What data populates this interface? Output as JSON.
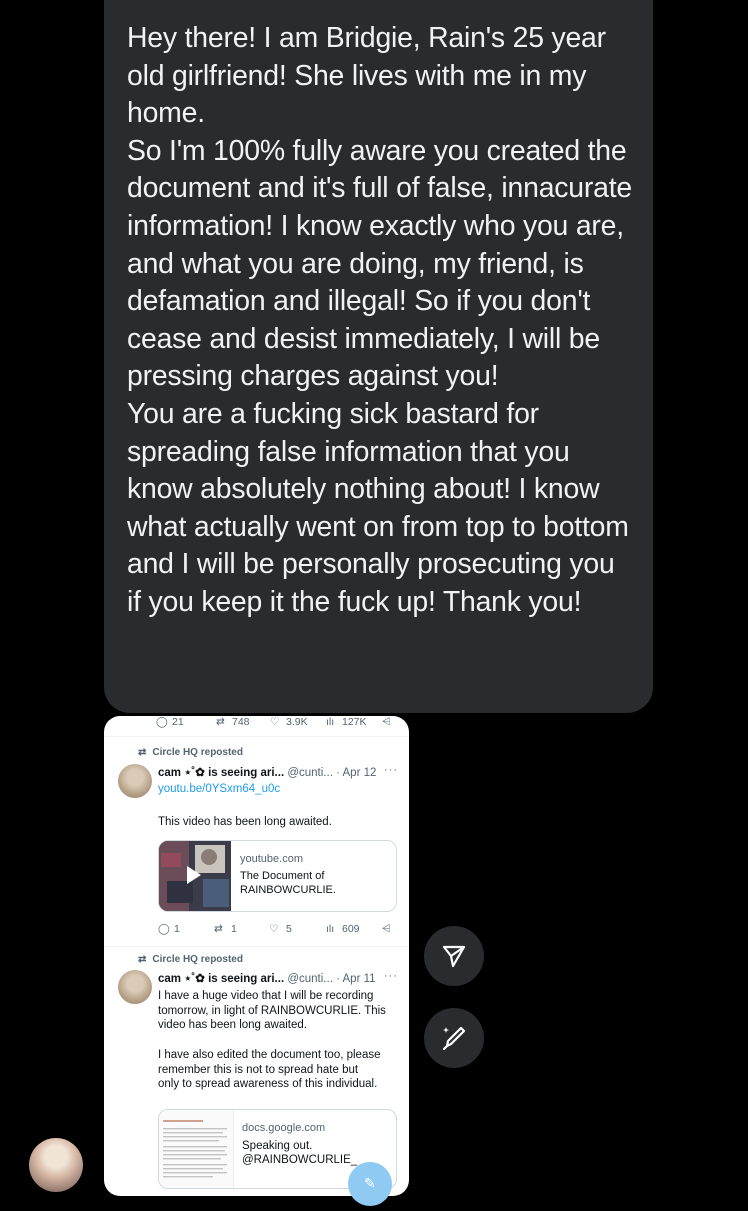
{
  "message": {
    "paragraphs": [
      "Hey there! I am Bridgie, Rain's 25 year old girlfriend! She lives with me in my home.",
      "So I'm 100% fully aware you created the document and it's full of false, innacurate information! I know exactly who you are, and what you are doing, my friend, is defamation and illegal! So if you don't cease and desist immediately, I will be pressing charges against you!",
      "You are a fucking sick bastard for spreading false information that you know absolutely nothing about! I know what actually went on from top to bottom and I will be personally prosecuting you if you keep it the fuck up! Thank you!"
    ]
  },
  "screenshot": {
    "top_actions": {
      "replies": "21",
      "reposts": "748",
      "likes": "3.9K",
      "views": "127K"
    },
    "posts": [
      {
        "repost_label": "Circle HQ reposted",
        "display_name": "cam ⋆˚✿ is seeing ari...",
        "handle": "@cunti...",
        "date": "· Apr 12",
        "link": "youtu.be/0YSxm64_u0c",
        "text": "This video has been long awaited.",
        "card": {
          "domain": "youtube.com",
          "title": "The Document of RAINBOWCURLIE."
        },
        "actions": {
          "replies": "1",
          "reposts": "1",
          "likes": "5",
          "views": "609"
        }
      },
      {
        "repost_label": "Circle HQ reposted",
        "display_name": "cam ⋆˚✿ is seeing ari...",
        "handle": "@cunti...",
        "date": "· Apr 11",
        "text_lines": [
          "I have a huge video that I will be recording",
          "tomorrow, in light of RAINBOWCURLIE. This",
          "video has been long awaited.",
          "",
          "I have also edited the document too, please",
          "remember this is not to spread hate but",
          "only to spread awareness of this individual."
        ],
        "card": {
          "domain": "docs.google.com",
          "title": "Speaking out. @RAINBOWCURLIE_"
        }
      }
    ]
  },
  "icons": {
    "send": "send-icon",
    "sticker": "sticker-icon",
    "compose": "compose-icon",
    "more": "···",
    "repost": "repost-icon"
  }
}
